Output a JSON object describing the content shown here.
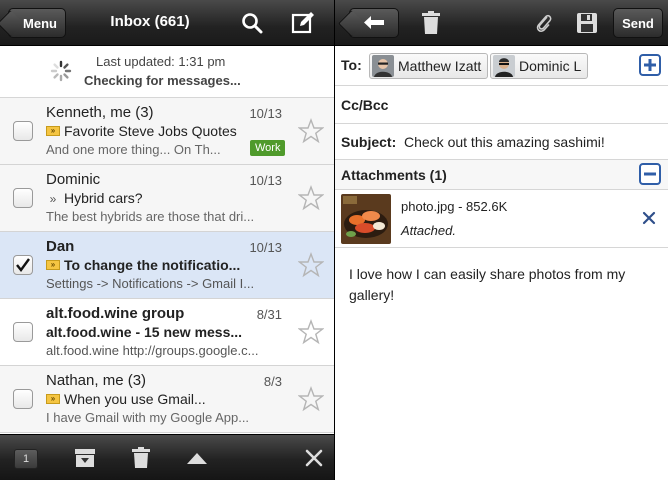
{
  "left": {
    "menu_label": "Menu",
    "inbox_title": "Inbox (661)",
    "status": {
      "updated": "Last updated: 1:31 pm",
      "checking": "Checking for messages..."
    },
    "messages": [
      {
        "from": "Kenneth, me (3)",
        "date": "10/13",
        "subject": "Favorite Steve Jobs Quotes",
        "snippet": "And one more thing... On Th...",
        "label": "Work",
        "important": true
      },
      {
        "from": "Dominic",
        "date": "10/13",
        "subject": "Hybrid cars?",
        "snippet": "The best hybrids are those that dri...",
        "important": false
      },
      {
        "from": "Dan",
        "date": "10/13",
        "subject": "To change the notificatio...",
        "snippet": "Settings -> Notifications -> Gmail I...",
        "important": true,
        "checked": true
      },
      {
        "from": "alt.food.wine group",
        "date": "8/31",
        "subject": "alt.food.wine - 15 new mess...",
        "snippet": "alt.food.wine http://groups.google.c..."
      },
      {
        "from": "Nathan, me (3)",
        "date": "8/3",
        "subject": "When you use Gmail...",
        "snippet": "I have Gmail with my Google App...",
        "important": true
      }
    ],
    "bottom": {
      "selected_count": "1"
    }
  },
  "right": {
    "send_label": "Send",
    "to_label": "To:",
    "recipients": [
      "Matthew Izatt",
      "Dominic L"
    ],
    "ccbcc_label": "Cc/Bcc",
    "subject_label": "Subject:",
    "subject_value": "Check out this amazing sashimi!",
    "attachments_label": "Attachments (1)",
    "attachment": {
      "name": "photo.jpg - 852.6K",
      "status": "Attached."
    },
    "body": "I love how I can easily share photos from my gallery!"
  },
  "colors": {
    "toolbar": "#222222",
    "selected_row": "#dbe6f6",
    "work_label": "#4f9a2b",
    "important_marker": "#f5c542",
    "accent_blue": "#2f5ea8"
  },
  "icons": [
    "search-icon",
    "compose-icon",
    "back-arrow-icon",
    "trash-icon",
    "paperclip-icon",
    "save-icon",
    "archive-icon",
    "chevron-up-icon",
    "close-icon",
    "star-icon",
    "plus-icon",
    "minus-icon"
  ]
}
